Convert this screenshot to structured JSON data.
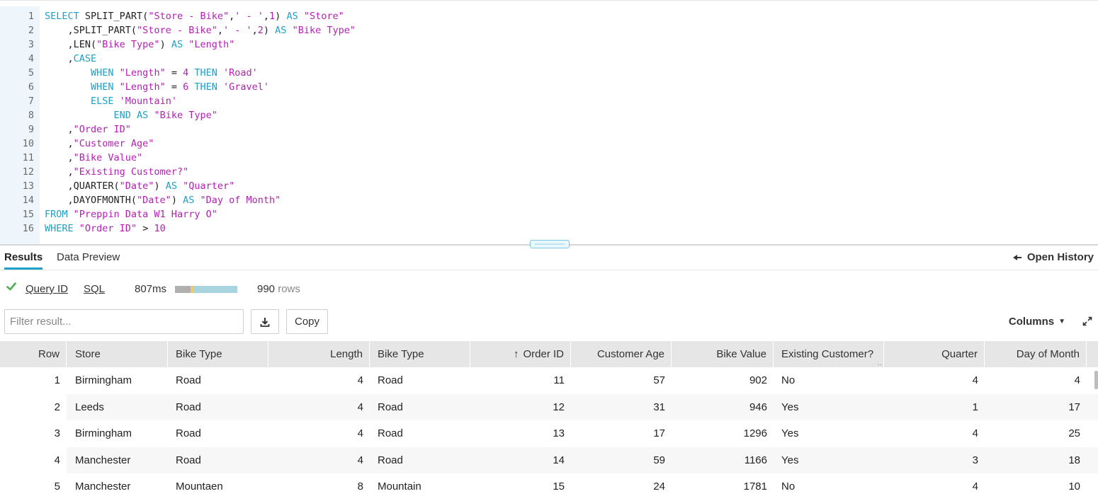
{
  "editor": {
    "lines": [
      {
        "n": "1",
        "tokens": [
          [
            "kw",
            "SELECT "
          ],
          [
            "fn",
            "SPLIT_PART("
          ],
          [
            "str",
            "\"Store - Bike\""
          ],
          [
            "op",
            ","
          ],
          [
            "str",
            "' - '"
          ],
          [
            "op",
            ","
          ],
          [
            "num",
            "1"
          ],
          [
            "op",
            ") "
          ],
          [
            "kw",
            "AS "
          ],
          [
            "str",
            "\"Store\""
          ]
        ]
      },
      {
        "n": "2",
        "tokens": [
          [
            "op",
            "    ,SPLIT_PART("
          ],
          [
            "str",
            "\"Store - Bike\""
          ],
          [
            "op",
            ","
          ],
          [
            "str",
            "' - '"
          ],
          [
            "op",
            ","
          ],
          [
            "num",
            "2"
          ],
          [
            "op",
            ") "
          ],
          [
            "kw",
            "AS "
          ],
          [
            "str",
            "\"Bike Type\""
          ]
        ]
      },
      {
        "n": "3",
        "tokens": [
          [
            "op",
            "    ,LEN("
          ],
          [
            "str",
            "\"Bike Type\""
          ],
          [
            "op",
            ") "
          ],
          [
            "kw",
            "AS "
          ],
          [
            "str",
            "\"Length\""
          ]
        ]
      },
      {
        "n": "4",
        "tokens": [
          [
            "op",
            "    ,"
          ],
          [
            "kw",
            "CASE"
          ]
        ]
      },
      {
        "n": "5",
        "tokens": [
          [
            "kw",
            "        WHEN "
          ],
          [
            "str",
            "\"Length\""
          ],
          [
            "op",
            " = "
          ],
          [
            "num",
            "4"
          ],
          [
            "kw",
            " THEN "
          ],
          [
            "str",
            "'Road'"
          ]
        ]
      },
      {
        "n": "6",
        "tokens": [
          [
            "kw",
            "        WHEN "
          ],
          [
            "str",
            "\"Length\""
          ],
          [
            "op",
            " = "
          ],
          [
            "num",
            "6"
          ],
          [
            "kw",
            " THEN "
          ],
          [
            "str",
            "'Gravel'"
          ]
        ]
      },
      {
        "n": "7",
        "tokens": [
          [
            "kw",
            "        ELSE "
          ],
          [
            "str",
            "'Mountain'"
          ]
        ]
      },
      {
        "n": "8",
        "tokens": [
          [
            "kw",
            "            END AS "
          ],
          [
            "str",
            "\"Bike Type\""
          ]
        ]
      },
      {
        "n": "9",
        "tokens": [
          [
            "op",
            "    ,"
          ],
          [
            "str",
            "\"Order ID\""
          ]
        ]
      },
      {
        "n": "10",
        "tokens": [
          [
            "op",
            "    ,"
          ],
          [
            "str",
            "\"Customer Age\""
          ]
        ]
      },
      {
        "n": "11",
        "tokens": [
          [
            "op",
            "    ,"
          ],
          [
            "str",
            "\"Bike Value\""
          ]
        ]
      },
      {
        "n": "12",
        "tokens": [
          [
            "op",
            "    ,"
          ],
          [
            "str",
            "\"Existing Customer?\""
          ]
        ]
      },
      {
        "n": "13",
        "tokens": [
          [
            "op",
            "    ,QUARTER("
          ],
          [
            "str",
            "\"Date\""
          ],
          [
            "op",
            ") "
          ],
          [
            "kw",
            "AS "
          ],
          [
            "str",
            "\"Quarter\""
          ]
        ]
      },
      {
        "n": "14",
        "tokens": [
          [
            "op",
            "    ,DAYOFMONTH("
          ],
          [
            "str",
            "\"Date\""
          ],
          [
            "op",
            ") "
          ],
          [
            "kw",
            "AS "
          ],
          [
            "str",
            "\"Day of Month\""
          ]
        ]
      },
      {
        "n": "15",
        "tokens": [
          [
            "kw",
            "FROM "
          ],
          [
            "str",
            "\"Preppin Data W1 Harry O\""
          ]
        ]
      },
      {
        "n": "16",
        "tokens": [
          [
            "kw",
            "WHERE "
          ],
          [
            "str",
            "\"Order ID\""
          ],
          [
            "op",
            " > "
          ],
          [
            "num",
            "10"
          ]
        ]
      }
    ]
  },
  "tabs": {
    "results": "Results",
    "data_preview": "Data Preview",
    "open_history": "Open History"
  },
  "status": {
    "query_id": "Query ID",
    "sql": "SQL",
    "duration": "807ms",
    "rows_count": "990",
    "rows_label": "rows"
  },
  "toolbar": {
    "filter_placeholder": "Filter result...",
    "copy_label": "Copy",
    "columns_label": "Columns",
    "columns_caret": "▼"
  },
  "table": {
    "columns": [
      "Row",
      "Store",
      "Bike Type",
      "Length",
      "Bike Type",
      "Order ID",
      "Customer Age",
      "Bike Value",
      "Existing Customer?",
      "Quarter",
      "Day of Month"
    ],
    "rows": [
      [
        "1",
        "Birmingham",
        "Road",
        "4",
        "Road",
        "11",
        "57",
        "902",
        "No",
        "4",
        "4"
      ],
      [
        "2",
        "Leeds",
        "Road",
        "4",
        "Road",
        "12",
        "31",
        "946",
        "Yes",
        "1",
        "17"
      ],
      [
        "3",
        "Birmingham",
        "Road",
        "4",
        "Road",
        "13",
        "17",
        "1296",
        "Yes",
        "4",
        "25"
      ],
      [
        "4",
        "Manchester",
        "Road",
        "4",
        "Road",
        "14",
        "59",
        "1166",
        "Yes",
        "3",
        "18"
      ],
      [
        "5",
        "Manchester",
        "Mountaen",
        "8",
        "Mountain",
        "15",
        "24",
        "1781",
        "No",
        "4",
        "10"
      ]
    ]
  },
  "colors": {
    "keyword": "#1fa0c8",
    "string": "#b31fb3",
    "success": "#4caf50",
    "accent": "#1fa0c8"
  },
  "icons": {
    "success": "check-icon",
    "download": "download-icon",
    "expand": "expand-icon",
    "back": "arrow-left-icon",
    "sort": "sort-up-icon"
  }
}
